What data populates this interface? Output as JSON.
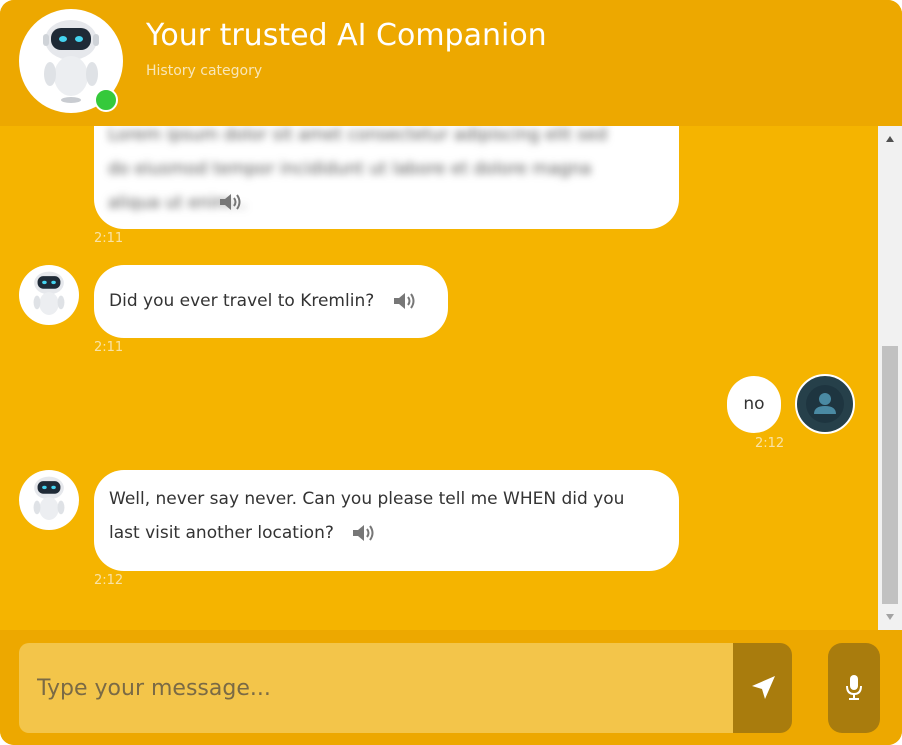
{
  "header": {
    "title": "Your trusted AI Companion",
    "subtitle": "History category"
  },
  "messages": [
    {
      "sender": "bot",
      "blurred": true,
      "text_lines": [
        "Lorem ipsum dolor sit amet consectetur adipiscing elit sed",
        "do eiusmod tempor incididunt ut labore et dolore magna",
        "aliqua ut enim..."
      ],
      "time": "2:11"
    },
    {
      "sender": "bot",
      "text": "Did you ever travel to Kremlin?",
      "time": "2:11"
    },
    {
      "sender": "user",
      "text": "no",
      "time": "2:12"
    },
    {
      "sender": "bot",
      "text_lines": [
        "Well, never say never. Can you please tell me WHEN did you",
        "last visit another location?"
      ],
      "time": "2:12"
    }
  ],
  "input": {
    "placeholder": "Type your message..."
  },
  "icons": {
    "send": "send-icon",
    "mic": "microphone-icon",
    "speaker": "speaker-icon",
    "user": "user-icon",
    "robot": "robot-avatar-icon"
  },
  "colors": {
    "background": "#f5b400",
    "header": "#eda800",
    "button": "#a97c0d",
    "bubble": "#ffffff",
    "online": "#35c93b"
  }
}
